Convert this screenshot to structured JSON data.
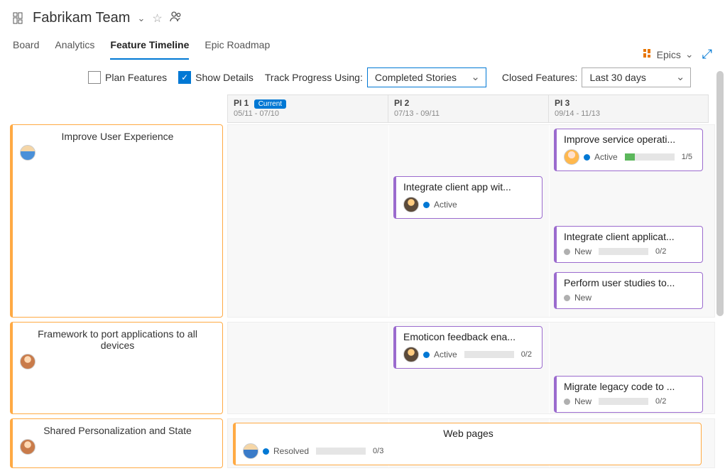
{
  "header": {
    "team_name": "Fabrikam Team"
  },
  "tabs": [
    {
      "label": "Board"
    },
    {
      "label": "Analytics"
    },
    {
      "label": "Feature Timeline"
    },
    {
      "label": "Epic Roadmap"
    }
  ],
  "right": {
    "epics_label": "Epics"
  },
  "toolbar": {
    "plan_features_label": "Plan Features",
    "show_details_label": "Show Details",
    "track_label": "Track Progress Using:",
    "track_value": "Completed Stories",
    "closed_label": "Closed Features:",
    "closed_value": "Last 30 days"
  },
  "columns": [
    {
      "name": "PI 1",
      "dates": "05/11 - 07/10",
      "current_label": "Current"
    },
    {
      "name": "PI 2",
      "dates": "07/13 - 09/11"
    },
    {
      "name": "PI 3",
      "dates": "09/14 - 11/13"
    }
  ],
  "epics": [
    {
      "title": "Improve User Experience",
      "features": [
        {
          "title": "Integrate client app wit...",
          "state": "Active"
        },
        {
          "title": "Improve service operati...",
          "state": "Active",
          "progress_text": "1/5",
          "progress_pct": 20
        },
        {
          "title": "Integrate client applicat...",
          "state": "New",
          "progress_text": "0/2",
          "progress_pct": 0
        },
        {
          "title": "Perform user studies to...",
          "state": "New"
        }
      ]
    },
    {
      "title": "Framework to port applications to all devices",
      "features": [
        {
          "title": "Emoticon feedback ena...",
          "state": "Active",
          "progress_text": "0/2",
          "progress_pct": 0
        },
        {
          "title": "Migrate legacy code to ...",
          "state": "New",
          "progress_text": "0/2",
          "progress_pct": 0
        }
      ]
    },
    {
      "title": "Shared Personalization and State",
      "features": [
        {
          "title": "Web pages",
          "state": "Resolved",
          "progress_text": "0/3",
          "progress_pct": 0
        }
      ]
    }
  ]
}
